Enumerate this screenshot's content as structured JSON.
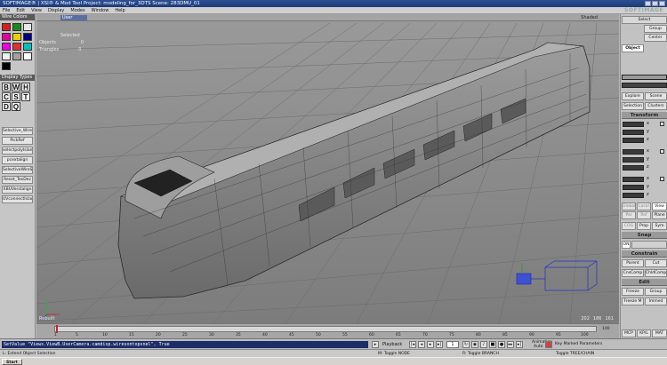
{
  "window": {
    "title": "SOFTIMAGE® | XSI® & Mod Tool Project: modeling_for_3DTS    Scene: 283DMU_01"
  },
  "menu": {
    "items": [
      "File",
      "Edit",
      "View",
      "Display",
      "Modes",
      "Window",
      "Help"
    ],
    "logo": "SOFTIMAGE"
  },
  "left_panel": {
    "wire_colors_title": "Wire Colors",
    "swatches": [
      "#d42020",
      "#1a8a1a",
      "#e8e8e8",
      "#e000a0",
      "#e8d000",
      "#000080",
      "#f000e8",
      "#e03030",
      "#00c0c0",
      "#f0f0f0",
      "#a0a0a0",
      "#ffffff",
      "#000000"
    ],
    "display_types_title": "Display Types",
    "display_types": [
      "B",
      "W",
      "H",
      "C",
      "S",
      "T",
      "D",
      "Q"
    ],
    "commands": [
      "Selective_Wire",
      "PickRef",
      "selectpolyIsland",
      "pcextalign",
      "SelectiveWireSameV",
      "Reset_TexDec",
      "XBUVerstalign",
      "UVconnectIsland+"
    ]
  },
  "viewport": {
    "camera": "User",
    "mode_label": "Shaded",
    "stats_header": "Selected",
    "stats": [
      {
        "label": "Objects",
        "value": "0"
      },
      {
        "label": "Triangles",
        "value": "0"
      }
    ],
    "bottom_left": "Rebuilt",
    "bottom_right_values": [
      "202",
      "186",
      "161"
    ]
  },
  "right_panel": {
    "top_buttons": [
      "Select",
      "Group",
      "Center"
    ],
    "object_label": "Object",
    "explore_buttons": [
      "Explore",
      "Scene"
    ],
    "selection_buttons": [
      "Selection",
      "Clusters"
    ],
    "transform_header": "Transform",
    "transform_axes": [
      "x",
      "y",
      "z",
      "x",
      "y",
      "z",
      "x",
      "y",
      "z"
    ],
    "ref_tabs": [
      "Global",
      "Local",
      "View"
    ],
    "ref_tabs2": [
      "Par",
      "Ref",
      "Plane"
    ],
    "cog_tabs": [
      "COG",
      "Prop",
      "Sym"
    ],
    "snap_header": "Snap",
    "snap_on": "ON",
    "constrain_header": "Constrain",
    "constrain_buttons": [
      "Parent",
      "Cut",
      "CnsComp",
      "ChldComp"
    ],
    "edit_header": "Edit",
    "edit_buttons": [
      "Freeze",
      "Group",
      "Freeze M",
      "Immed"
    ],
    "bottom_tabs": [
      "MCP",
      "KP/L",
      "MAT"
    ]
  },
  "timeline": {
    "ticks": [
      "1",
      "5",
      "10",
      "15",
      "20",
      "25",
      "30",
      "35",
      "40",
      "45",
      "50",
      "55",
      "60",
      "65",
      "70",
      "75",
      "80",
      "85",
      "90",
      "95",
      "100"
    ],
    "end_frame": "100"
  },
  "script": {
    "command": "SetValue \"Views.ViewB.UserCamera.camdisp.wiresontopsnel\", True"
  },
  "playback": {
    "playback_label": "Playback",
    "current_frame": "1",
    "animation_label": "Animation",
    "auto_label": "Auto",
    "key_marked": "Key Marked Parameters"
  },
  "status": {
    "left": "L: Extend Object Selection",
    "mid1": "M: Toggle NODE",
    "mid2": "R: Toggle BRANCH",
    "right": "Toggle TREE/CHAIN"
  },
  "taskbar": {
    "start": "Start"
  }
}
